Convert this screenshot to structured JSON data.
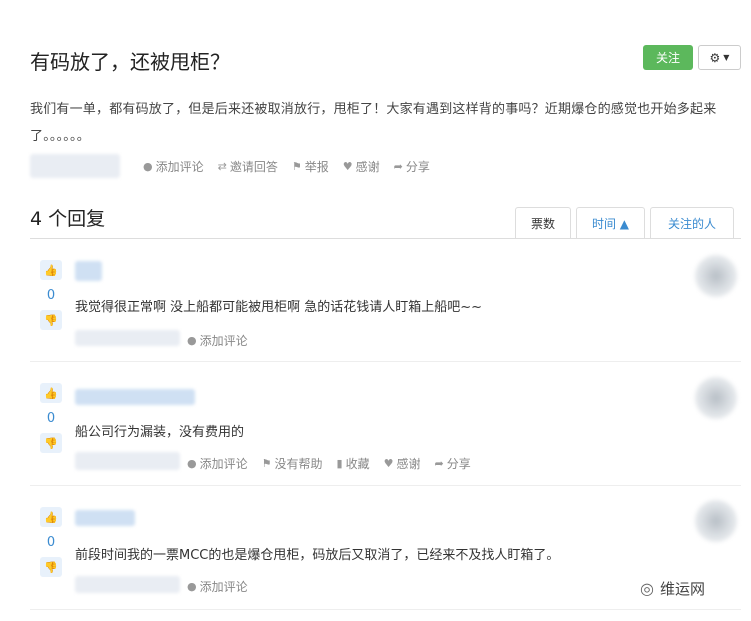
{
  "question": {
    "title": "有码放了，还被甩柜？",
    "follow_label": "关注",
    "settings_icon": "gear-icon",
    "body": "我们有一单，都有码放了，但是后来还被取消放行，甩柜了！大家有遇到这样背的事吗？近期爆仓的感觉也开始多起来了。。。。。。",
    "actions": [
      {
        "icon": "comment-icon",
        "label": "添加评论"
      },
      {
        "icon": "retweet-icon",
        "label": "邀请回答"
      },
      {
        "icon": "flag-icon",
        "label": "举报"
      },
      {
        "icon": "heart-icon",
        "label": "感谢"
      },
      {
        "icon": "share-icon",
        "label": "分享"
      }
    ]
  },
  "answers_header": {
    "count_label": "4 个回复",
    "tabs": [
      {
        "label": "票数",
        "active": true
      },
      {
        "label": "时间 ▲",
        "active": false
      },
      {
        "label": "关注的人",
        "active": false
      }
    ]
  },
  "answers": [
    {
      "votes": "0",
      "text": "我觉得很正常啊 没上船都可能被甩柜啊 急的话花钱请人盯箱上船吧~~",
      "actions": [
        {
          "icon": "comment-icon",
          "label": "添加评论"
        }
      ]
    },
    {
      "votes": "0",
      "text": "船公司行为漏装，没有费用的",
      "actions": [
        {
          "icon": "comment-icon",
          "label": "添加评论"
        },
        {
          "icon": "flag-icon",
          "label": "没有帮助"
        },
        {
          "icon": "bookmark-icon",
          "label": "收藏"
        },
        {
          "icon": "heart-icon",
          "label": "感谢"
        },
        {
          "icon": "share-icon",
          "label": "分享"
        }
      ]
    },
    {
      "votes": "0",
      "text": "前段时间我的一票MCC的也是爆仓甩柜，码放后又取消了，已经来不及找人盯箱了。",
      "actions": [
        {
          "icon": "comment-icon",
          "label": "添加评论"
        }
      ]
    }
  ],
  "watermark": {
    "icon": "wechat-icon",
    "label": "维运网"
  },
  "colors": {
    "accent": "#3a8bd0",
    "follow": "#5cb85c"
  }
}
